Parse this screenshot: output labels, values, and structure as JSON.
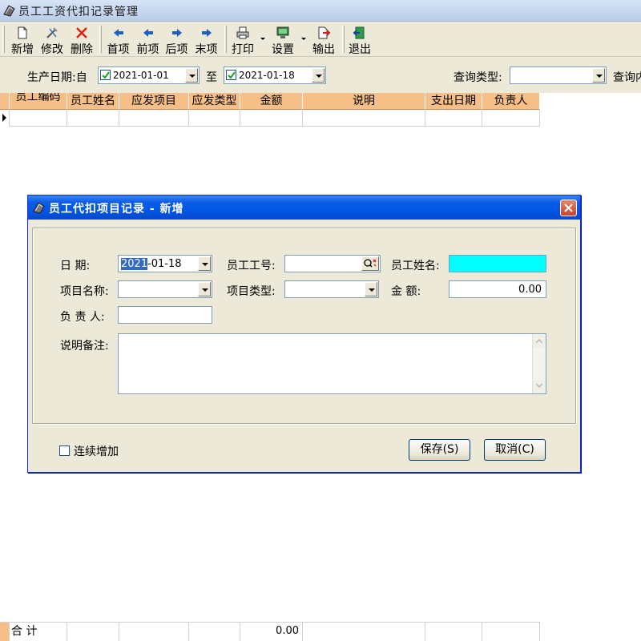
{
  "window": {
    "title": "员工工资代扣记录管理"
  },
  "toolbar": {
    "buttons": [
      {
        "label": "新增",
        "icon": "new-document-icon"
      },
      {
        "label": "修改",
        "icon": "edit-tools-icon"
      },
      {
        "label": "删除",
        "icon": "delete-x-icon"
      },
      {
        "label": "首项",
        "icon": "first-arrow-icon"
      },
      {
        "label": "前项",
        "icon": "previous-arrow-icon"
      },
      {
        "label": "后项",
        "icon": "next-arrow-icon"
      },
      {
        "label": "末项",
        "icon": "last-arrow-icon"
      },
      {
        "label": "打印",
        "icon": "printer-icon"
      },
      {
        "label": "设置",
        "icon": "settings-monitor-icon"
      },
      {
        "label": "输出",
        "icon": "export-icon"
      },
      {
        "label": "退出",
        "icon": "exit-door-icon"
      }
    ]
  },
  "filter": {
    "date_label": "生产日期:自",
    "date_from": "2021-01-01",
    "to_label": "至",
    "date_to": "2021-01-18",
    "query_type_label": "查询类型:",
    "query_type_value": "",
    "query_content_label": "查询内"
  },
  "grid": {
    "columns": [
      "员工编码",
      "员工姓名",
      "应发项目",
      "应发类型",
      "金额",
      "说明",
      "支出日期",
      "负责人"
    ],
    "footer_label": "合  计",
    "footer_amount": "0.00"
  },
  "dialog": {
    "title": "员工代扣项目记录 - 新增",
    "date_label": "日    期:",
    "date_selected_part": "2021",
    "date_rest": "-01-18",
    "emp_no_label": "员工工号:",
    "emp_no_value": "",
    "emp_name_label": "员工姓名:",
    "emp_name_value": "",
    "item_name_label": "项目名称:",
    "item_name_value": "",
    "item_type_label": "项目类型:",
    "item_type_value": "",
    "amount_label": "金    额:",
    "amount_value": "0.00",
    "owner_label": "负 责 人:",
    "owner_value": "",
    "memo_label": "说明备注:",
    "memo_value": "",
    "continuous_label": "连续增加",
    "save_label": "保存(S)",
    "cancel_label": "取消(C)"
  },
  "colors": {
    "grid_header": "#f6bf88",
    "dialog_title": "#0054e3",
    "highlight_field": "#00ffff",
    "window_bg": "#ece9d8"
  }
}
